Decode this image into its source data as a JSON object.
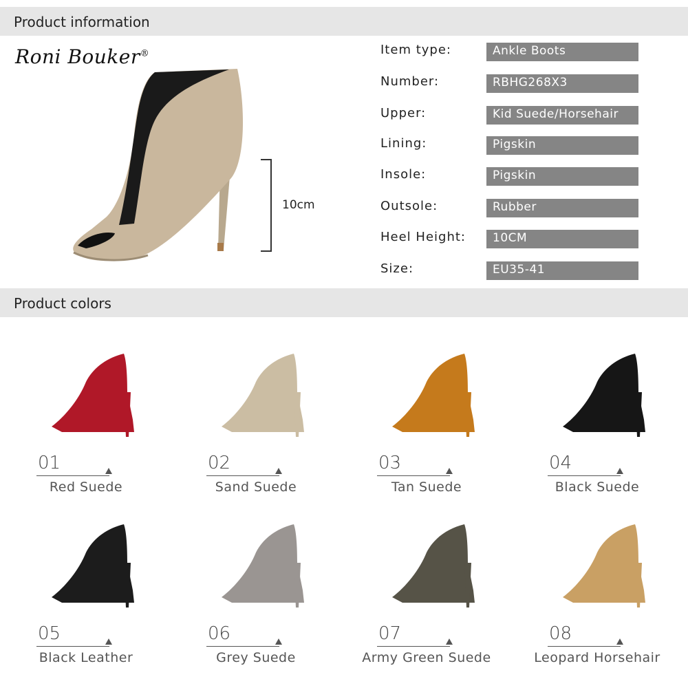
{
  "sections": {
    "info_title": "Product information",
    "colors_title": "Product colors"
  },
  "brand": {
    "name": "Roni Bouker",
    "mark": "®"
  },
  "hero": {
    "dimension_label": "10cm",
    "color": "#c9b79d"
  },
  "specs": [
    {
      "label": "Item type:",
      "value": "Ankle Boots"
    },
    {
      "label": "Number:",
      "value": "RBHG268X3"
    },
    {
      "label": "Upper:",
      "value": "Kid Suede/Horsehair"
    },
    {
      "label": "Lining:",
      "value": "Pigskin"
    },
    {
      "label": "Insole:",
      "value": "Pigskin"
    },
    {
      "label": "Outsole:",
      "value": "Rubber"
    },
    {
      "label": "Heel Height:",
      "value": "10CM"
    },
    {
      "label": "Size:",
      "value": "EU35-41"
    }
  ],
  "colors": [
    {
      "number": "01",
      "name": "Red Suede",
      "swatch": "#b01828"
    },
    {
      "number": "02",
      "name": "Sand Suede",
      "swatch": "#cbbda3"
    },
    {
      "number": "03",
      "name": "Tan Suede",
      "swatch": "#c57a1c"
    },
    {
      "number": "04",
      "name": "Black Suede",
      "swatch": "#161616"
    },
    {
      "number": "05",
      "name": "Black Leather",
      "swatch": "#1c1c1c"
    },
    {
      "number": "06",
      "name": "Grey Suede",
      "swatch": "#9a9592"
    },
    {
      "number": "07",
      "name": "Army Green Suede",
      "swatch": "#565347"
    },
    {
      "number": "08",
      "name": "Leopard Horsehair",
      "swatch": "#c9a064"
    }
  ]
}
